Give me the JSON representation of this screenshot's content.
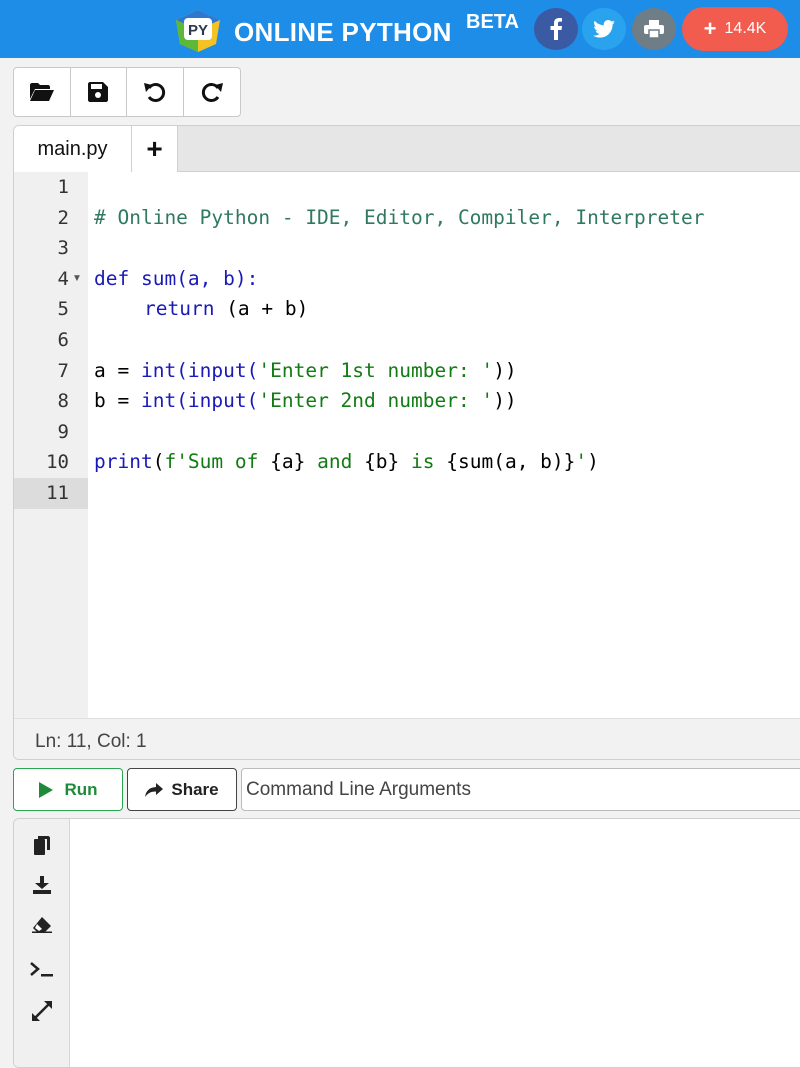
{
  "header": {
    "brand": "ONLINE PYTHON",
    "beta": "BETA",
    "logo_text": "PY",
    "share_count": "14.4K",
    "colors": {
      "bar": "#1e8de8",
      "facebook": "#3a5aa3",
      "twitter": "#2aa3ef",
      "print": "#6e7d86",
      "counter": "#f25c4e"
    }
  },
  "toolbar": {
    "icons": [
      "folder-open-icon",
      "save-icon",
      "undo-icon",
      "redo-icon"
    ]
  },
  "tabs": {
    "active": "main.py",
    "add": "+"
  },
  "editor": {
    "lines": [
      {
        "num": "1"
      },
      {
        "num": "2"
      },
      {
        "num": "3"
      },
      {
        "num": "4"
      },
      {
        "num": "5"
      },
      {
        "num": "6"
      },
      {
        "num": "7"
      },
      {
        "num": "8"
      },
      {
        "num": "9"
      },
      {
        "num": "10"
      },
      {
        "num": "11"
      }
    ],
    "code": {
      "l2": "# Online Python - IDE, Editor, Compiler, Interpreter",
      "l4_kw": "def",
      "l4_rest": " sum(a, b):",
      "l5_kw": "return",
      "l5_rest": " (a + b)",
      "l7_a": "a = ",
      "l7_fn": "int(input(",
      "l7_str": "'Enter 1st number: '",
      "l7_end": "))",
      "l8_a": "b = ",
      "l8_fn": "int(input(",
      "l8_str": "'Enter 2nd number: '",
      "l8_end": "))",
      "l10_fn": "print",
      "l10_open": "(",
      "l10_s1": "f'Sum of ",
      "l10_a": "{a}",
      "l10_s2": " and ",
      "l10_b": "{b}",
      "l10_s3": " is ",
      "l10_sum": "{sum(a, b)}",
      "l10_s4": "'",
      "l10_close": ")"
    },
    "active_line": 11,
    "status": "Ln: 11,  Col: 1"
  },
  "run": {
    "run_label": "Run",
    "share_label": "Share",
    "args_placeholder": "Command Line Arguments"
  },
  "output": {
    "icons": [
      "copy-icon",
      "download-icon",
      "eraser-icon",
      "terminal-icon",
      "expand-icon"
    ]
  }
}
